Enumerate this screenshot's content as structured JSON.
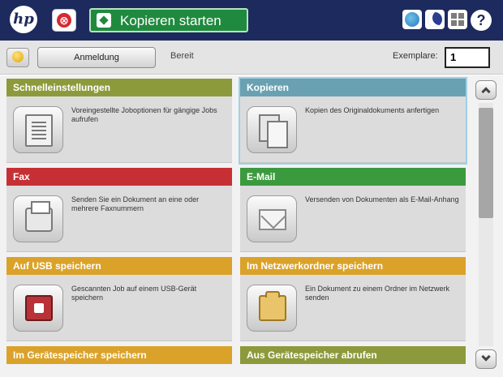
{
  "topbar": {
    "logo": "hp",
    "stop_symbol": "⊗",
    "start_label": "Kopieren starten",
    "help_symbol": "?",
    "icons": [
      "globe-icon",
      "sleep-moon-icon",
      "network-icon"
    ]
  },
  "status": {
    "signin_label": "Anmeldung",
    "state": "Bereit",
    "copies_label": "Exemplare:",
    "copies_value": "1"
  },
  "tiles": [
    {
      "title": "Schnelleinstellungen",
      "desc": "Voreingestellte Joboptionen für gängige Jobs aufrufen",
      "icon": "quick-sets-icon",
      "color": "#8d9a3c"
    },
    {
      "title": "Kopieren",
      "desc": "Kopien des Originaldokuments anfertigen",
      "icon": "copy-icon",
      "color": "#6aa1b2",
      "selected": true
    },
    {
      "title": "Fax",
      "desc": "Senden Sie ein Dokument an eine oder mehrere Faxnummern",
      "icon": "fax-icon",
      "color": "#c63034"
    },
    {
      "title": "E-Mail",
      "desc": "Versenden von Dokumenten als E-Mail-Anhang",
      "icon": "email-icon",
      "color": "#3c9a3e"
    },
    {
      "title": "Auf USB speichern",
      "desc": "Gescannten Job auf einem USB-Gerät speichern",
      "icon": "usb-icon",
      "color": "#dba22a"
    },
    {
      "title": "Im Netzwerkordner speichern",
      "desc": "Ein Dokument zu einem Ordner im Netzwerk senden",
      "icon": "network-folder-icon",
      "color": "#dba22a"
    },
    {
      "title": "Im Gerätespeicher speichern",
      "color": "#dba22a"
    },
    {
      "title": "Aus Gerätespeicher abrufen",
      "color": "#8d9a3c"
    }
  ]
}
